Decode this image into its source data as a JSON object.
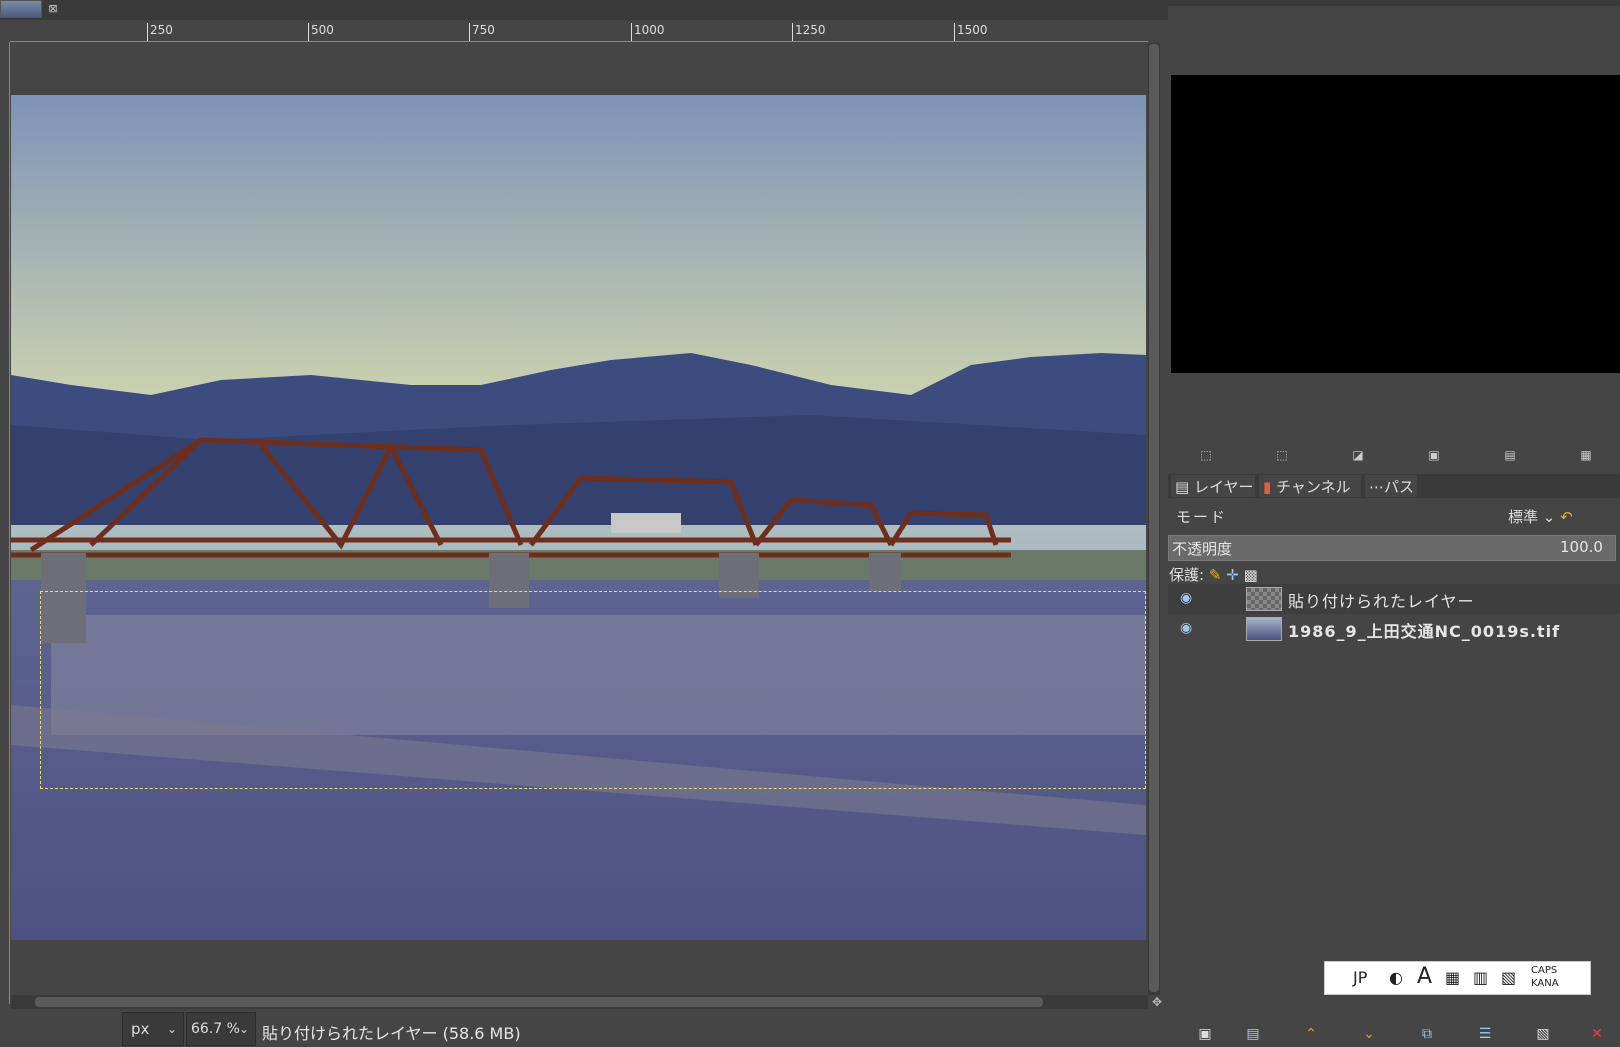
{
  "ruler": {
    "marks": [
      "250",
      "500",
      "750",
      "1000",
      "1250",
      "1500"
    ]
  },
  "tab": {
    "close_icon": "close-icon"
  },
  "status": {
    "unit": "px",
    "zoom": "66.7 %",
    "text": "貼り付けられたレイヤー (58.6 MB)"
  },
  "layers_panel": {
    "tabs": [
      "レイヤー",
      "チャンネル",
      "パス"
    ],
    "mode_label": "モード",
    "mode_value": "標準",
    "opacity_label": "不透明度",
    "opacity_value": "100.0",
    "protect_label": "保護:",
    "layers": [
      {
        "name": "貼り付けられたレイヤー",
        "visible": true
      },
      {
        "name": "1986_9_上田交通NC_0019s.tif",
        "visible": true
      }
    ]
  },
  "ime": {
    "lang": "JP",
    "caps": "CAPS",
    "kana": "KANA"
  },
  "colors": {
    "accent": "#9ec8ee",
    "selection": "#e8e070",
    "bg": "#454545"
  }
}
